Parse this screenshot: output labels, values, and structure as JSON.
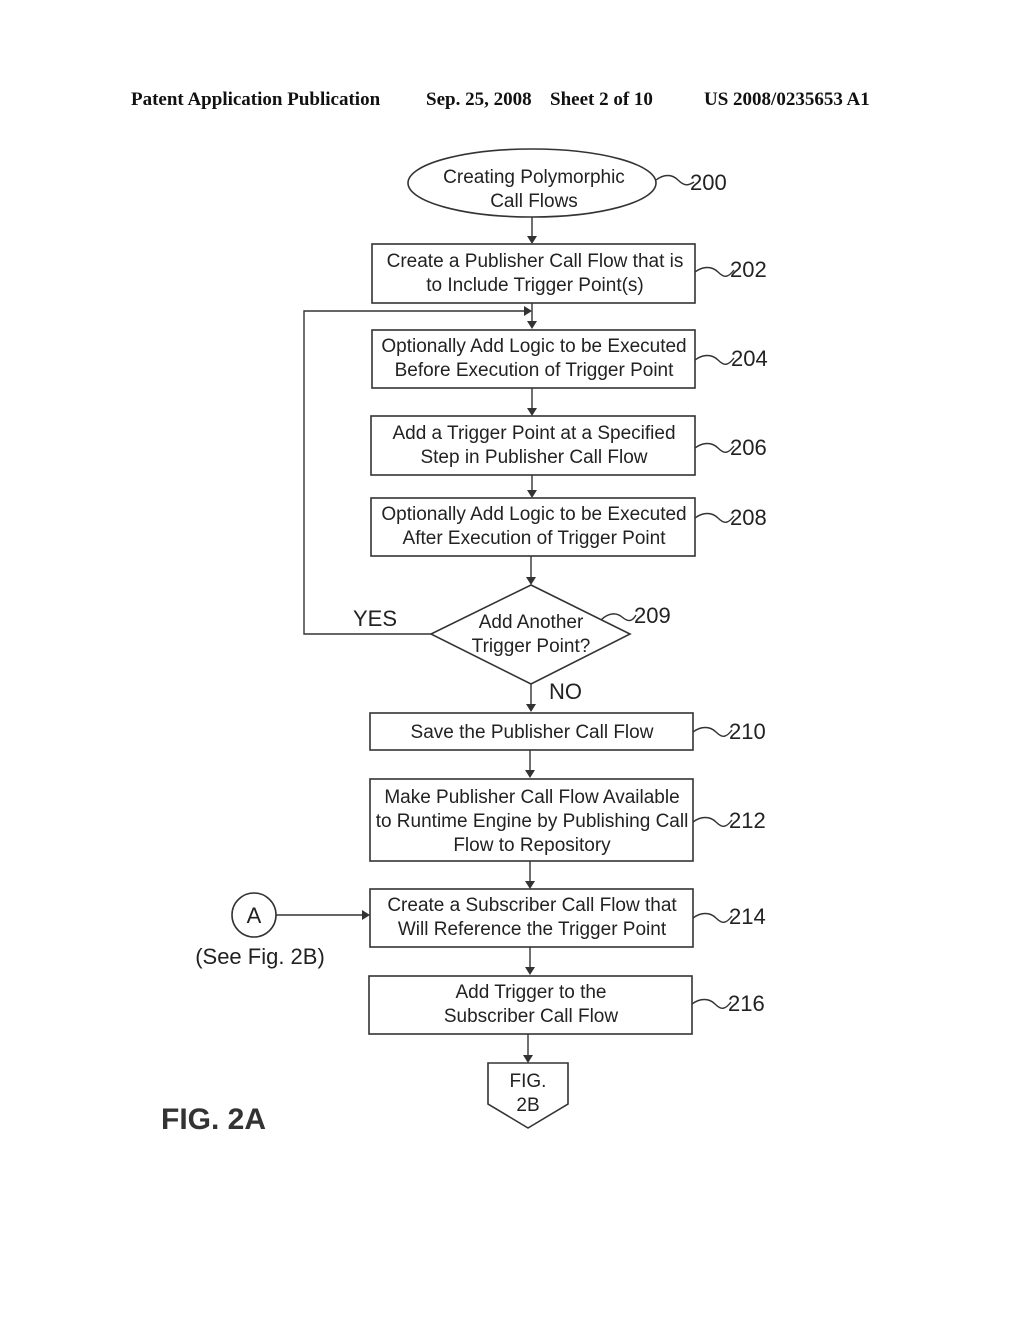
{
  "header": {
    "left": "Patent Application Publication",
    "date": "Sep. 25, 2008",
    "sheet": "Sheet 2 of 10",
    "number": "US 2008/0235653 A1"
  },
  "figure_label": "FIG. 2A",
  "nodes": {
    "start": {
      "lines": [
        "Creating Polymorphic",
        "Call Flows"
      ],
      "ref": "200"
    },
    "n202": {
      "lines": [
        "Create a Publisher Call Flow that is",
        "to Include Trigger Point(s)"
      ],
      "ref": "202"
    },
    "n204": {
      "lines": [
        "Optionally Add Logic to be Executed",
        "Before Execution of Trigger Point"
      ],
      "ref": "204"
    },
    "n206": {
      "lines": [
        "Add a Trigger Point at a Specified",
        "Step in Publisher Call Flow"
      ],
      "ref": "206"
    },
    "n208": {
      "lines": [
        "Optionally Add Logic to be Executed",
        "After Execution of Trigger Point"
      ],
      "ref": "208"
    },
    "n209": {
      "lines": [
        "Add Another",
        "Trigger Point?"
      ],
      "ref": "209",
      "yes_label": "YES",
      "no_label": "NO"
    },
    "n210": {
      "lines": [
        "Save the Publisher Call Flow"
      ],
      "ref": "210"
    },
    "n212": {
      "lines": [
        "Make Publisher Call Flow Available",
        "to Runtime Engine by Publishing Call",
        "Flow to Repository"
      ],
      "ref": "212"
    },
    "n214": {
      "lines": [
        "Create a Subscriber Call Flow that",
        "Will Reference the Trigger Point"
      ],
      "ref": "214"
    },
    "n216": {
      "lines": [
        "Add Trigger to the",
        "Subscriber Call Flow"
      ],
      "ref": "216"
    },
    "connector_a": {
      "label": "A",
      "note": "(See Fig. 2B)"
    },
    "offpage": {
      "lines": [
        "FIG.",
        "2B"
      ]
    }
  }
}
